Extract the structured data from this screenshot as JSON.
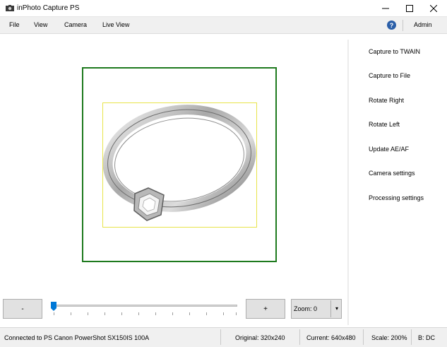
{
  "window": {
    "title": "inPhoto Capture PS"
  },
  "menu": {
    "file": "File",
    "view": "View",
    "camera": "Camera",
    "live_view": "Live View",
    "help_icon": "?",
    "admin": "Admin"
  },
  "actions": [
    "Capture to TWAIN",
    "Capture to File",
    "Rotate Right",
    "Rotate Left",
    "Update AE/AF",
    "Camera settings",
    "Processing settings"
  ],
  "controls": {
    "minus": "-",
    "plus": "+",
    "zoom_label": "Zoom: 0",
    "zoom_level": 0,
    "slider_position": 0
  },
  "status": {
    "connection": "Connected to PS Canon PowerShot SX150IS 100A",
    "original": "Original: 320x240",
    "current": "Current: 640x480",
    "scale": "Scale: 200%",
    "b": "B: DC"
  },
  "colors": {
    "frame": "#1e7a1e",
    "crop": "#e8e44a",
    "accent": "#0078d7"
  },
  "icons": [
    "app-camera-icon",
    "minimize-icon",
    "maximize-icon",
    "close-icon",
    "help-icon",
    "chevron-down-icon"
  ]
}
